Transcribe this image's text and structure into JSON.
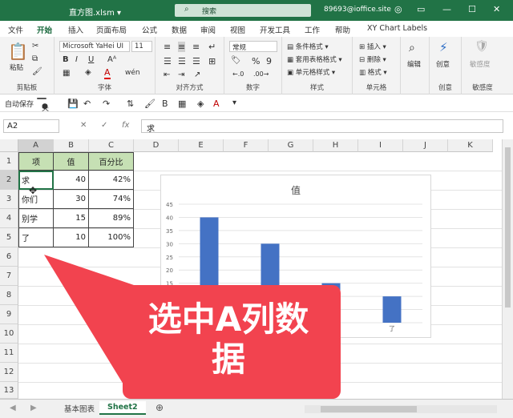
{
  "window": {
    "title": "直方图.xlsm ▾",
    "search_placeholder": "搜索",
    "account": "89693@ioffice.site"
  },
  "tabs": [
    "文件",
    "开始",
    "插入",
    "页面布局",
    "公式",
    "数据",
    "审阅",
    "视图",
    "开发工具",
    "工作",
    "帮助",
    "XY Chart Labels"
  ],
  "ribbon": {
    "paste": "粘贴",
    "clipboard": "剪贴板",
    "font_name": "Microsoft YaHei UI",
    "font_size": "11",
    "font_group": "字体",
    "align_group": "对齐方式",
    "number_format": "常规",
    "number_group": "数字",
    "cond_format": "条件格式 ▾",
    "table_format": "套用表格格式 ▾",
    "cell_style": "单元格样式 ▾",
    "style_group": "样式",
    "insert": "插入 ▾",
    "delete": "删除 ▾",
    "format": "格式 ▾",
    "cells_group": "单元格",
    "edit": "编辑",
    "create": "创意",
    "sensitivity": "敏感度",
    "bold": "B",
    "italic": "I",
    "underline": "U",
    "font_color": "A",
    "cn_font": "wén"
  },
  "qat": {
    "autosave": "自动保存",
    "autosave_state": "关"
  },
  "formula_bar": {
    "name_box": "A2",
    "fx": "fx",
    "value": "求"
  },
  "columns": [
    "A",
    "B",
    "C",
    "D",
    "E",
    "F",
    "G",
    "H",
    "I",
    "J",
    "K"
  ],
  "rows": [
    "1",
    "2",
    "3",
    "4",
    "5",
    "6",
    "7",
    "8",
    "9",
    "10",
    "11",
    "12",
    "13"
  ],
  "table": {
    "headers": [
      "项",
      "值",
      "百分比"
    ],
    "rows": [
      [
        "求",
        "40",
        "42%"
      ],
      [
        "你们",
        "30",
        "74%"
      ],
      [
        "别学",
        "15",
        "89%"
      ],
      [
        "了",
        "10",
        "100%"
      ]
    ]
  },
  "chart_data": {
    "type": "bar",
    "title": "值",
    "categories": [
      "求",
      "你们",
      "别学",
      "了"
    ],
    "values": [
      40,
      30,
      15,
      10
    ],
    "ylim": [
      0,
      45
    ],
    "yticks": [
      "45",
      "40",
      "35",
      "30",
      "25",
      "20",
      "15"
    ],
    "visible_category_label": "了",
    "bar_color": "#4472c4"
  },
  "callout": {
    "text_line1": "选中A列数",
    "text_line2": "据",
    "color": "#f2434f"
  },
  "sheets": [
    "基本图表",
    "Sheet2"
  ],
  "active_sheet": "Sheet2"
}
